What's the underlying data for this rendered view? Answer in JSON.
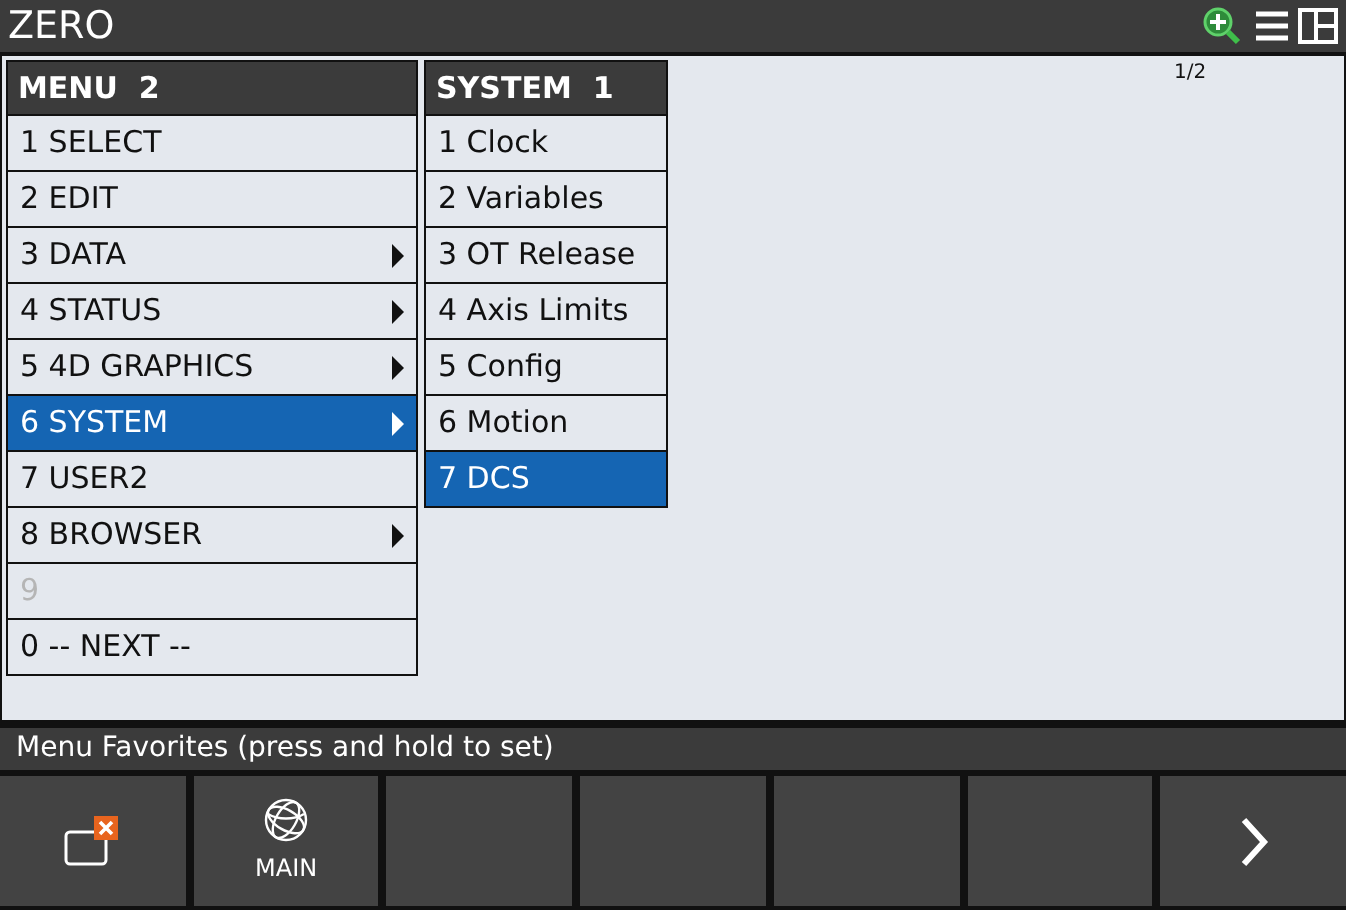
{
  "window": {
    "title": "ZERO",
    "page_indicator": "1/2"
  },
  "menus": [
    {
      "title": "MENU  2",
      "items": [
        {
          "label": "1 SELECT",
          "submenu": false,
          "selected": false,
          "disabled": false
        },
        {
          "label": "2 EDIT",
          "submenu": false,
          "selected": false,
          "disabled": false
        },
        {
          "label": "3 DATA",
          "submenu": true,
          "selected": false,
          "disabled": false
        },
        {
          "label": "4 STATUS",
          "submenu": true,
          "selected": false,
          "disabled": false
        },
        {
          "label": "5 4D GRAPHICS",
          "submenu": true,
          "selected": false,
          "disabled": false
        },
        {
          "label": "6 SYSTEM",
          "submenu": true,
          "selected": true,
          "disabled": false
        },
        {
          "label": "7 USER2",
          "submenu": false,
          "selected": false,
          "disabled": false
        },
        {
          "label": "8 BROWSER",
          "submenu": true,
          "selected": false,
          "disabled": false
        },
        {
          "label": "9",
          "submenu": false,
          "selected": false,
          "disabled": true
        },
        {
          "label": "0 -- NEXT --",
          "submenu": false,
          "selected": false,
          "disabled": false
        }
      ]
    },
    {
      "title": "SYSTEM  1",
      "items": [
        {
          "label": "1 Clock",
          "submenu": false,
          "selected": false,
          "disabled": false
        },
        {
          "label": "2 Variables",
          "submenu": false,
          "selected": false,
          "disabled": false
        },
        {
          "label": "3 OT Release",
          "submenu": false,
          "selected": false,
          "disabled": false
        },
        {
          "label": "4 Axis Limits",
          "submenu": false,
          "selected": false,
          "disabled": false
        },
        {
          "label": "5 Config",
          "submenu": false,
          "selected": false,
          "disabled": false
        },
        {
          "label": "6 Motion",
          "submenu": false,
          "selected": false,
          "disabled": false
        },
        {
          "label": "7 DCS",
          "submenu": false,
          "selected": true,
          "disabled": false
        }
      ]
    }
  ],
  "favorites_bar": {
    "text": "Menu Favorites (press and hold to set)"
  },
  "function_keys": [
    {
      "kind": "close-window"
    },
    {
      "kind": "globe",
      "label": "MAIN"
    },
    {
      "kind": "empty"
    },
    {
      "kind": "empty"
    },
    {
      "kind": "empty"
    },
    {
      "kind": "empty"
    },
    {
      "kind": "next"
    }
  ]
}
